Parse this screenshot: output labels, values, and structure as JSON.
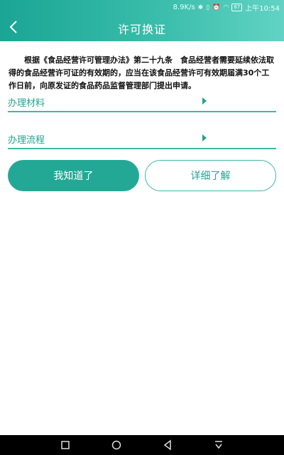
{
  "status_bar": {
    "network_speed": "8.9K/s",
    "battery": "87",
    "time": "上午10:54"
  },
  "header": {
    "title": "许可换证",
    "back_icon": "chevron-left-icon"
  },
  "notice": {
    "text": "根据《食品经营许可管理办法》第二十九条　食品经营者需要延续依法取得的食品经营许可证的有效期的，应当在该食品经营许可有效期届满30个工作日前，向原发证的食品药品监督管理部门提出申请。"
  },
  "rows": [
    {
      "label": "办理材料",
      "icon": "triangle-right-icon"
    },
    {
      "label": "办理流程",
      "icon": "triangle-right-icon"
    }
  ],
  "buttons": {
    "primary_label": "我知道了",
    "secondary_label": "详细了解"
  },
  "colors": {
    "accent": "#24a896",
    "header_gradient_start": "#1aa594",
    "header_gradient_end": "#62d3c4"
  }
}
